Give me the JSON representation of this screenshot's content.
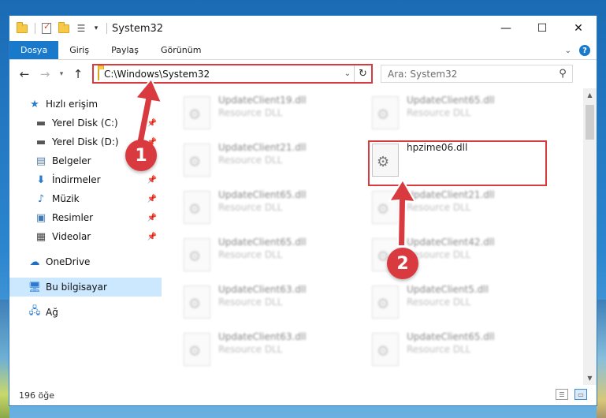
{
  "window": {
    "title": "System32",
    "controls": {
      "minimize": "—",
      "maximize": "☐",
      "close": "✕"
    }
  },
  "ribbon": {
    "tabs": [
      "Dosya",
      "Giriş",
      "Paylaş",
      "Görünüm"
    ],
    "help": "?"
  },
  "address": {
    "path": "C:\\Windows\\System32",
    "search_placeholder": "Ara: System32"
  },
  "nav": {
    "quick_access": "Hızlı erişim",
    "pinned": [
      {
        "label": "Yerel Disk (C:)",
        "icon": "drive-icon"
      },
      {
        "label": "Yerel Disk (D:)",
        "icon": "drive-icon"
      },
      {
        "label": "Belgeler",
        "icon": "documents-icon"
      },
      {
        "label": "İndirmeler",
        "icon": "downloads-icon"
      },
      {
        "label": "Müzik",
        "icon": "music-icon"
      },
      {
        "label": "Resimler",
        "icon": "pictures-icon"
      },
      {
        "label": "Videolar",
        "icon": "videos-icon"
      }
    ],
    "onedrive": "OneDrive",
    "this_pc": "Bu bilgisayar",
    "network": "Ağ"
  },
  "files": {
    "left_column": [
      {
        "name": "UpdateClient19.dll",
        "type": "Resource DLL"
      },
      {
        "name": "UpdateClient21.dll",
        "type": "Resource DLL"
      },
      {
        "name": "UpdateClient65.dll",
        "type": "Resource DLL"
      },
      {
        "name": "UpdateClient65.dll",
        "type": "Resource DLL"
      },
      {
        "name": "UpdateClient63.dll",
        "type": "Resource DLL"
      },
      {
        "name": "UpdateClient63.dll",
        "type": "Resource DLL"
      }
    ],
    "right_column": [
      {
        "name": "UpdateClient65.dll",
        "type": "Resource DLL"
      },
      {
        "name": "hpzime06.dll",
        "type": ""
      },
      {
        "name": "UpdateClient21.dll",
        "type": "Resource DLL"
      },
      {
        "name": "UpdateClient42.dll",
        "type": "Resource DLL"
      },
      {
        "name": "UpdateClient5.dll",
        "type": "Resource DLL"
      },
      {
        "name": "UpdateClient65.dll",
        "type": "Resource DLL"
      }
    ]
  },
  "status": {
    "count": "196 öğe"
  },
  "annotations": {
    "step1": "1",
    "step2": "2"
  },
  "colors": {
    "accent": "#1979ca",
    "annotation": "#d83a3f"
  }
}
